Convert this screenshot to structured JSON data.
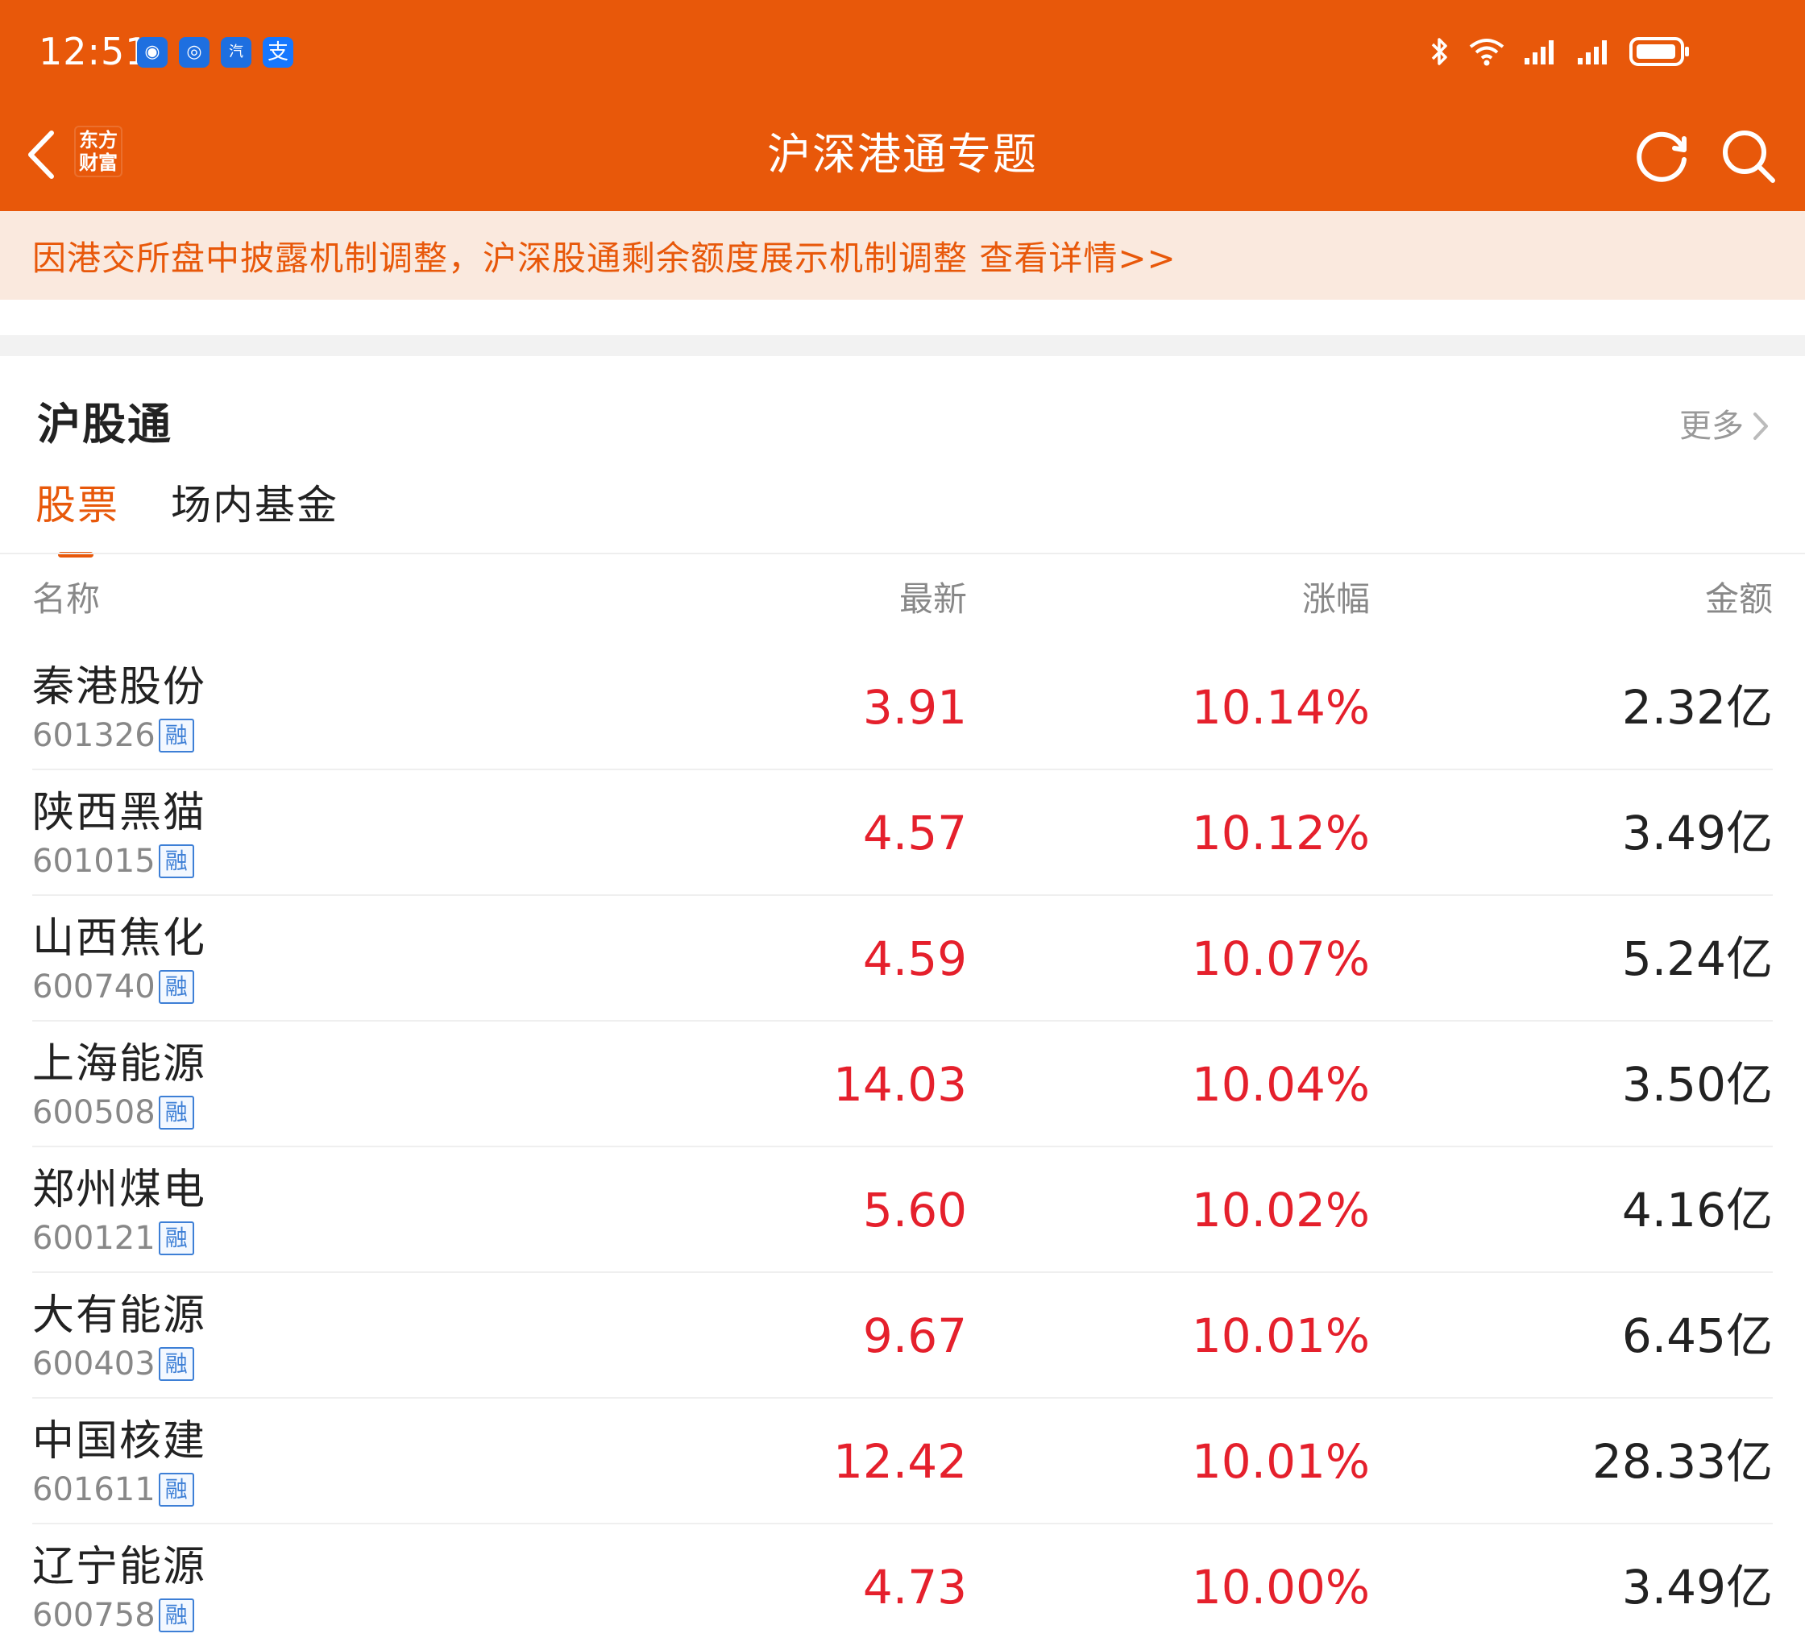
{
  "status_bar": {
    "time": "12:51",
    "apps": [
      {
        "icon": "message-icon",
        "glyph": "◉"
      },
      {
        "icon": "app-icon",
        "glyph": "◎"
      },
      {
        "icon": "car-home-icon",
        "glyph": "汽"
      },
      {
        "icon": "alipay-icon",
        "glyph": "支"
      }
    ]
  },
  "nav": {
    "title": "沪深港通专题",
    "logo_line1": "东方",
    "logo_line2": "财富"
  },
  "notice": {
    "text": "因港交所盘中披露机制调整，沪深股通剩余额度展示机制调整 查看详情>>"
  },
  "section": {
    "title": "沪股通",
    "more_label": "更多"
  },
  "tabs": [
    {
      "label": "股票",
      "active": true
    },
    {
      "label": "场内基金",
      "active": false
    }
  ],
  "table": {
    "headers": {
      "name": "名称",
      "price": "最新",
      "change": "涨幅",
      "amount": "金额"
    },
    "badge": "融",
    "rows": [
      {
        "name": "秦港股份",
        "code": "601326",
        "price": "3.91",
        "change": "10.14%",
        "amount": "2.32亿"
      },
      {
        "name": "陕西黑猫",
        "code": "601015",
        "price": "4.57",
        "change": "10.12%",
        "amount": "3.49亿"
      },
      {
        "name": "山西焦化",
        "code": "600740",
        "price": "4.59",
        "change": "10.07%",
        "amount": "5.24亿"
      },
      {
        "name": "上海能源",
        "code": "600508",
        "price": "14.03",
        "change": "10.04%",
        "amount": "3.50亿"
      },
      {
        "name": "郑州煤电",
        "code": "600121",
        "price": "5.60",
        "change": "10.02%",
        "amount": "4.16亿"
      },
      {
        "name": "大有能源",
        "code": "600403",
        "price": "9.67",
        "change": "10.01%",
        "amount": "6.45亿"
      },
      {
        "name": "中国核建",
        "code": "601611",
        "price": "12.42",
        "change": "10.01%",
        "amount": "28.33亿"
      },
      {
        "name": "辽宁能源",
        "code": "600758",
        "price": "4.73",
        "change": "10.00%",
        "amount": "3.49亿"
      }
    ]
  },
  "colors": {
    "brand": "#E8580A",
    "rise": "#E5202C",
    "notice_bg": "#FAE9DE",
    "badge": "#3D7FD6"
  }
}
